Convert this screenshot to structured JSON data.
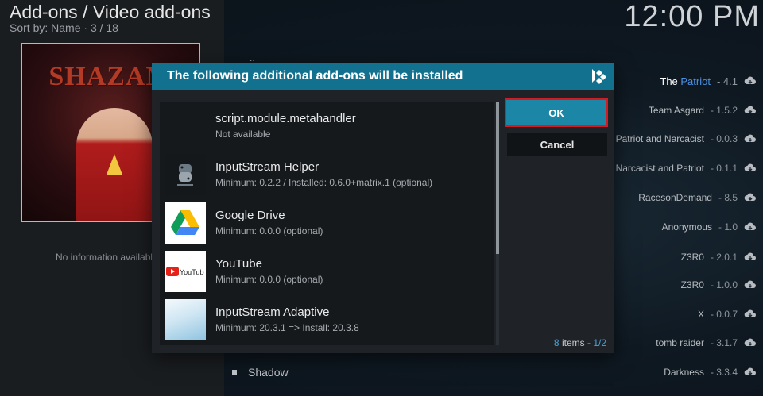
{
  "header": {
    "title": "Add-ons / Video add-ons",
    "sort_label": "Sort by: Name",
    "position": "3 / 18"
  },
  "clock": "12:00 PM",
  "poster": {
    "title": "SHAZAM"
  },
  "left_panel": {
    "no_info": "No information available"
  },
  "bg_list": {
    "dots": "..",
    "items": [
      {
        "prefix": "The ",
        "accent": "Patriot",
        "version": "4.1",
        "icon": "cloud-download-icon"
      },
      {
        "name": "Team Asgard",
        "version": "1.5.2",
        "icon": "cloud-download-icon"
      },
      {
        "name": "Patriot and Narcacist",
        "version": "0.0.3",
        "icon": "cloud-download-icon"
      },
      {
        "name": "Narcacist and Patriot",
        "version": "0.1.1",
        "icon": "cloud-download-icon"
      },
      {
        "name": "RacesonDemand",
        "version": "8.5",
        "icon": "cloud-download-icon"
      },
      {
        "name": "Anonymous",
        "version": "1.0",
        "icon": "cloud-download-icon"
      },
      {
        "name": "Z3R0",
        "version": "2.0.1",
        "icon": "cloud-download-icon"
      },
      {
        "name": "Z3R0",
        "version": "1.0.0",
        "icon": "cloud-download-icon"
      },
      {
        "name": "X",
        "version": "0.0.7",
        "icon": "cloud-download-icon"
      },
      {
        "name": "tomb raider",
        "version": "3.1.7",
        "icon": "cloud-download-icon"
      },
      {
        "name": "Darkness",
        "version": "3.3.4",
        "icon": "cloud-download-icon"
      }
    ],
    "shadow_item": "Shadow"
  },
  "dialog": {
    "title": "The following additional add-ons will be installed",
    "ok_label": "OK",
    "cancel_label": "Cancel",
    "items_count": "8",
    "items_word": "items",
    "page": "1/2",
    "addons": [
      {
        "name": "script.module.metahandler",
        "desc": "Not available",
        "thumb": "blank"
      },
      {
        "name": "InputStream Helper",
        "desc": "Minimum: 0.2.2 / Installed: 0.6.0+matrix.1 (optional)",
        "thumb": "python-logo"
      },
      {
        "name": "Google Drive",
        "desc": "Minimum: 0.0.0 (optional)",
        "thumb": "google-drive-logo"
      },
      {
        "name": "YouTube",
        "desc": "Minimum: 0.0.0 (optional)",
        "thumb": "youtube-logo"
      },
      {
        "name": "InputStream Adaptive",
        "desc": "Minimum: 20.3.1 => Install: 20.3.8",
        "thumb": "adaptive-thumb"
      }
    ]
  },
  "colors": {
    "dialog_header": "#12718e",
    "ok_button": "#1b86a6",
    "focus_border": "#d11c24",
    "accent": "#4a90e2"
  }
}
